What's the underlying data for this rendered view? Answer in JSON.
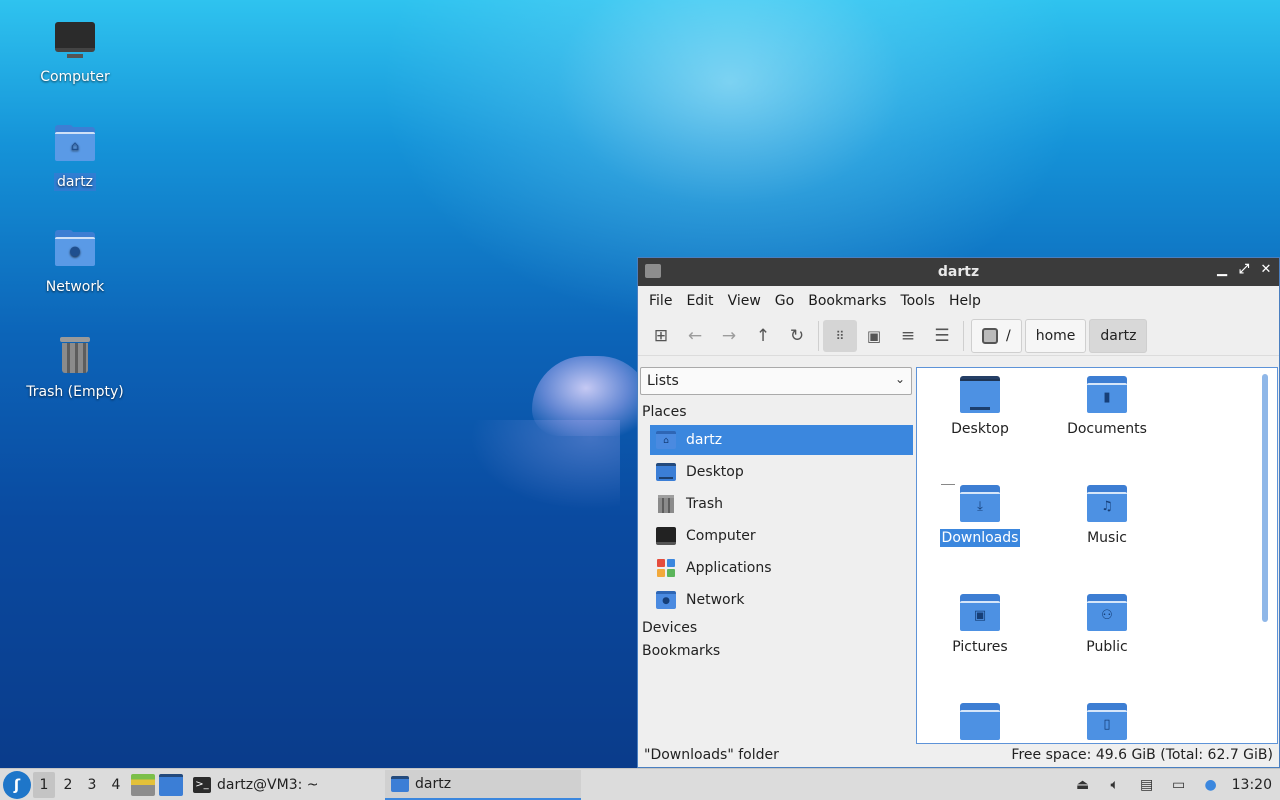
{
  "desktop": {
    "icons": [
      {
        "label": "Computer",
        "icon": "computer-icon"
      },
      {
        "label": "dartz",
        "icon": "home-folder-icon"
      },
      {
        "label": "Network",
        "icon": "network-folder-icon"
      },
      {
        "label": "Trash (Empty)",
        "icon": "trash-icon"
      }
    ]
  },
  "window": {
    "title": "dartz",
    "menu": [
      "File",
      "Edit",
      "View",
      "Go",
      "Bookmarks",
      "Tools",
      "Help"
    ],
    "path": {
      "root": "/",
      "segments": [
        "home",
        "dartz"
      ]
    },
    "sidebar": {
      "dropdown": "Lists",
      "places_header": "Places",
      "places": [
        {
          "label": "dartz",
          "icon": "home-folder-icon",
          "selected": true
        },
        {
          "label": "Desktop",
          "icon": "desktop-folder-icon"
        },
        {
          "label": "Trash",
          "icon": "trash-icon"
        },
        {
          "label": "Computer",
          "icon": "computer-icon"
        },
        {
          "label": "Applications",
          "icon": "applications-icon"
        },
        {
          "label": "Network",
          "icon": "network-folder-icon"
        }
      ],
      "devices_header": "Devices",
      "bookmarks_header": "Bookmarks"
    },
    "files": [
      {
        "label": "Desktop",
        "icon": "desktop-folder-icon"
      },
      {
        "label": "Documents",
        "icon": "documents-folder-icon"
      },
      {
        "label": "Downloads",
        "icon": "downloads-folder-icon",
        "selected": true
      },
      {
        "label": "Music",
        "icon": "music-folder-icon"
      },
      {
        "label": "Pictures",
        "icon": "pictures-folder-icon"
      },
      {
        "label": "Public",
        "icon": "public-folder-icon"
      },
      {
        "label": "",
        "icon": "folder-icon"
      },
      {
        "label": "",
        "icon": "templates-folder-icon"
      }
    ],
    "status": {
      "left": "\"Downloads\" folder",
      "right": "Free space: 49.6 GiB (Total: 62.7 GiB)"
    }
  },
  "taskbar": {
    "workspaces": [
      "1",
      "2",
      "3",
      "4"
    ],
    "active_workspace": "1",
    "tasks": [
      {
        "label": "dartz@VM3: ~",
        "icon": "terminal-icon"
      },
      {
        "label": "dartz",
        "icon": "folder-icon"
      }
    ],
    "clock": "13:20"
  },
  "colors": {
    "accent": "#3b87de",
    "folder": "#4d91e3",
    "titlebar": "#3b3b3b",
    "taskbar": "#dcdcdc"
  }
}
